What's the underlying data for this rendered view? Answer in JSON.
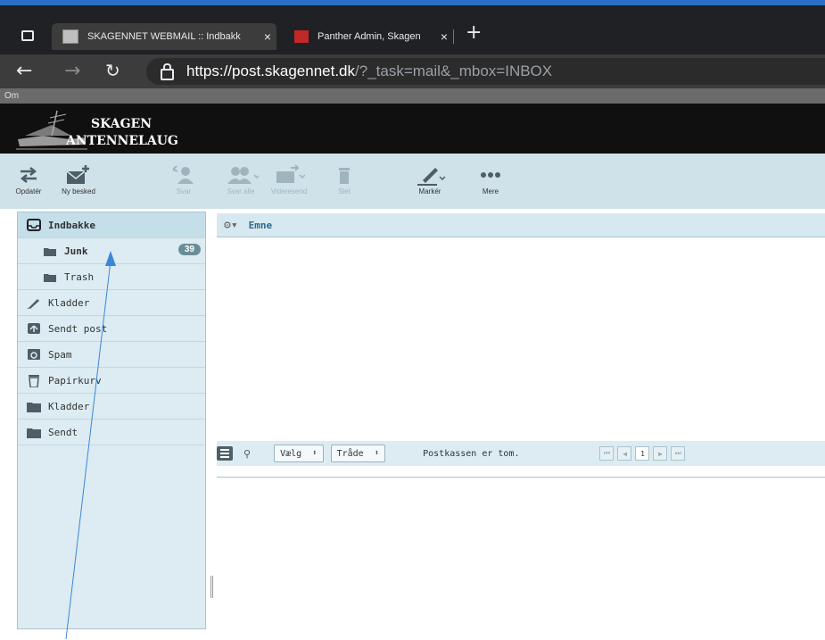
{
  "browser": {
    "tabs": [
      {
        "title": "SKAGENNET WEBMAIL :: Indbakk",
        "close": "×"
      },
      {
        "title": "Panther Admin, Skagen",
        "close": "×"
      }
    ],
    "new_tab": "+",
    "url_scheme": "https://",
    "url_host": "post.skagennet.dk",
    "url_path": "/?_task=mail&_mbox=INBOX"
  },
  "header": {
    "about_label": "Om",
    "logo_line1": "SKAGEN",
    "logo_line2": "ANTENNELAUG"
  },
  "toolbar": {
    "refresh": "Opdatér",
    "compose": "Ny besked",
    "reply": "Svar",
    "reply_all": "Svar alle",
    "forward": "Videresend",
    "delete": "Slet",
    "mark": "Markér",
    "more": "Mere"
  },
  "folders": [
    {
      "name": "Indbakke",
      "icon": "inbox-icon",
      "selected": true
    },
    {
      "name": "Junk",
      "icon": "folder-icon",
      "count": "39",
      "bold": true
    },
    {
      "name": "Trash",
      "icon": "folder-icon"
    },
    {
      "name": "Kladder",
      "icon": "pencil-icon"
    },
    {
      "name": "Sendt post",
      "icon": "sent-icon"
    },
    {
      "name": "Spam",
      "icon": "spam-icon"
    },
    {
      "name": "Papirkurv",
      "icon": "trash-icon"
    },
    {
      "name": "Kladder",
      "icon": "folder-icon"
    },
    {
      "name": "Sendt",
      "icon": "folder-icon"
    }
  ],
  "message_list": {
    "column_subject": "Emne",
    "select_label": "Vælg",
    "thread_label": "Tråde",
    "status": "Postkassen er tom.",
    "page": "1"
  }
}
